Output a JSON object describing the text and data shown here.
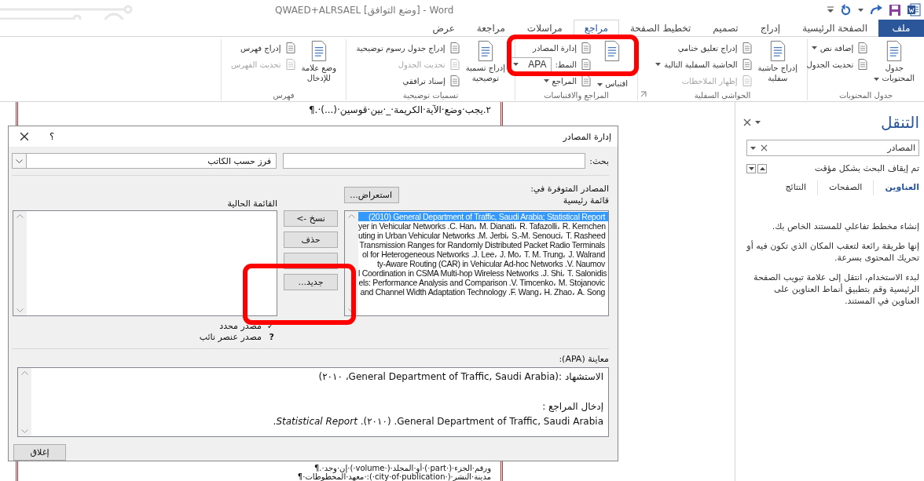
{
  "window": {
    "title": "QWAED+ALRSAEL [وضع التوافق] - Word"
  },
  "tabs": [
    {
      "label": "ملف",
      "kind": "file",
      "selected": false
    },
    {
      "label": "الصفحة الرئيسية",
      "kind": "tab",
      "selected": false
    },
    {
      "label": "إدراج",
      "kind": "tab",
      "selected": false
    },
    {
      "label": "تصميم",
      "kind": "tab",
      "selected": false
    },
    {
      "label": "تخطيط الصفحة",
      "kind": "tab",
      "selected": false
    },
    {
      "label": "مراجع",
      "kind": "tab",
      "selected": true
    },
    {
      "label": "مراسلات",
      "kind": "tab",
      "selected": false
    },
    {
      "label": "مراجعة",
      "kind": "tab",
      "selected": false
    },
    {
      "label": "عرض",
      "kind": "tab",
      "selected": false
    }
  ],
  "ribbon": {
    "groups": [
      {
        "label": "جدول المحتويات",
        "launcher": false,
        "large": [
          {
            "lines": [
              "جدول",
              "المحتويات"
            ],
            "menu": true
          }
        ],
        "small": [
          {
            "kind": "button",
            "label": "إضافة نص",
            "menu": true,
            "disabled": false
          },
          {
            "kind": "button",
            "label": "تحديث الجدول",
            "menu": false,
            "disabled": false
          }
        ]
      },
      {
        "label": "الحواشي السفلية",
        "launcher": true,
        "large": [
          {
            "lines": [
              "إدراج حاشية",
              "سفلية"
            ],
            "menu": false
          }
        ],
        "small": [
          {
            "kind": "button",
            "label": "إدراج تعليق ختامي",
            "menu": false,
            "disabled": false
          },
          {
            "kind": "button",
            "label": "الحاشية السفلية التالية",
            "menu": true,
            "disabled": false
          },
          {
            "kind": "button",
            "label": "إظهار الملاحظات",
            "menu": false,
            "disabled": true
          }
        ]
      },
      {
        "label": "المراجع والاقتباسات",
        "launcher": false,
        "large": [
          {
            "lines": [
              "اقتباس"
            ],
            "menu": true
          }
        ],
        "small": [
          {
            "kind": "button",
            "label": "إدارة المصادر",
            "menu": false,
            "disabled": false
          },
          {
            "kind": "style",
            "label": "النمط:",
            "value": "APA",
            "menu": true,
            "disabled": false
          },
          {
            "kind": "button",
            "label": "المراجع",
            "menu": true,
            "disabled": false
          }
        ]
      },
      {
        "label": "تسميات توضيحية",
        "launcher": false,
        "large": [
          {
            "lines": [
              "إدراج تسمية",
              "توضيحية"
            ],
            "menu": false
          }
        ],
        "small": [
          {
            "kind": "button",
            "label": "إدراج جدول رسوم توضيحية",
            "menu": false,
            "disabled": false
          },
          {
            "kind": "button",
            "label": "تحديث الجدول",
            "menu": false,
            "disabled": true
          },
          {
            "kind": "button",
            "label": "إسناد ترافقي",
            "menu": false,
            "disabled": false
          }
        ]
      },
      {
        "label": "فهرس",
        "launcher": false,
        "large": [
          {
            "lines": [
              "وضع علامة",
              "للإدخال"
            ],
            "menu": false
          }
        ],
        "small": [
          {
            "kind": "button",
            "label": "إدراج فهرس",
            "menu": false,
            "disabled": false
          },
          {
            "kind": "button",
            "label": "تحديث الفهرس",
            "menu": false,
            "disabled": true
          }
        ]
      }
    ]
  },
  "document": {
    "top_line": "٢.يجب·وضع·الآية·الكريمة·_·بين·قوسين·(...)·.¶",
    "bottom_lines": [
      "ورقم·الجزء·(·part·)·أو·المجلد·(·volume·)·إن·وجد·.¶",
      "مدينة·النشر·(·city·of·publication·):·معهد·المخطوطات·¶"
    ]
  },
  "dialog": {
    "title": "إدارة المصادر",
    "help": "؟",
    "search_label": "بحث:",
    "sort": "فرز حسب الكاتب",
    "sources_label": "المصادر المتوفرة في:",
    "source_location": "قائمة رئيسية",
    "browse": "استعراض...",
    "current_label": "القائمة الحالية",
    "master_list": [
      {
        "text": "(2010) General Department of Traffic, Saudi Arabia; Statistical Report",
        "selected": true
      },
      {
        "text": "yer in Vehicular Networks .C. Han، M. Dianati، R. Tafazolli، R. Kernchen",
        "selected": false
      },
      {
        "text": "uting in Urban Vehicular Networks .M. Jerbi، S.-M. Senouci، T. Rasheed",
        "selected": false
      },
      {
        "text": "Transmission Ranges for Randomly Distributed Packet Radio Terminals",
        "selected": false
      },
      {
        "text": "ol for Heterogeneous Networks .J. Lee، J. Mo، T. M. Trung، J. Walrand",
        "selected": false
      },
      {
        "text": "ty-Aware Routing (CAR) in Vehicular Ad-hoc Networks .V. Naumov",
        "selected": false
      },
      {
        "text": "l Coordination in CSMA Multi-hop Wireless Networks .J. Shi، T. Salonidis",
        "selected": false
      },
      {
        "text": "els: Performance Analysis and Comparison .V. Timcenko، M. Stojanovic",
        "selected": false
      },
      {
        "text": "and Channel Width Adaptation Technology .F. Wang، H. Zhao، A. Song",
        "selected": false
      }
    ],
    "actions": [
      {
        "kind": "text",
        "label": "نسخ ->"
      },
      {
        "kind": "text",
        "label": "حذف"
      },
      {
        "kind": "blank"
      },
      {
        "kind": "text",
        "label": "جديد..."
      }
    ],
    "legend": [
      {
        "mark": "✓",
        "label": "مصدر محدد"
      },
      {
        "mark": "?",
        "label": "مصدر عنصر نائب"
      }
    ],
    "preview_label": "معاينة (APA):",
    "preview": {
      "citation": "الاستشهاد  :(General Department of Traffic, Saudi Arabia، ٢٠١٠)",
      "entry_label": "إدخال المراجع :",
      "entry": "General Department of Traffic, Saudi Arabia. (٢٠١٠). *Statistical Report*."
    },
    "close": "إغلاق"
  },
  "navigation": {
    "title": "التنقل",
    "search_value": "المصادر",
    "status": "تم إيقاف البحث بشكل مؤقت",
    "tabs": [
      {
        "label": "العناوين",
        "selected": true
      },
      {
        "label": "الصفحات",
        "selected": false
      },
      {
        "label": "النتائج",
        "selected": false
      }
    ],
    "paragraphs": [
      "إنشاء مخطط تفاعلي للمستند الخاص بك.",
      "إنها طريقة رائعة لتعقب المكان الذي تكون فيه أو تحريك المحتوى بسرعة.",
      "لبدء الاستخدام، انتقل إلى علامة تبويب الصفحة الرئيسية وقم بتطبيق أنماط العناوين على العناوين في المستند."
    ]
  }
}
